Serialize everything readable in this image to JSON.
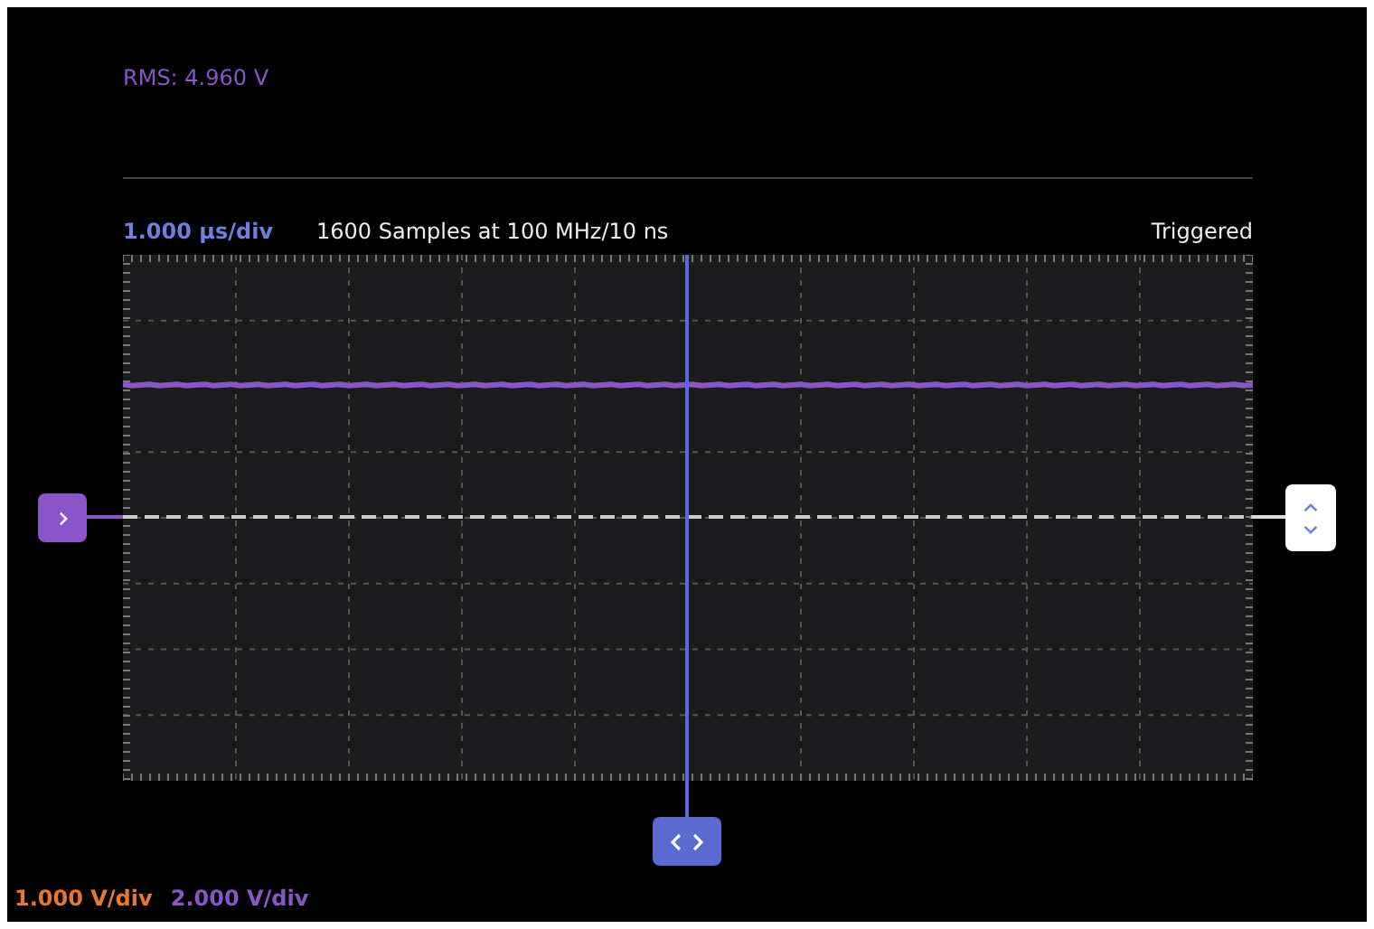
{
  "measurement": {
    "text": "RMS: 4.960 V"
  },
  "header": {
    "timebase": "1.000 µs/div",
    "sample_info": "1600 Samples at 100 MHz/10 ns",
    "trigger_status": "Triggered"
  },
  "channel_scales": [
    {
      "text": "1.000 V/div",
      "color": "#e8782a"
    },
    {
      "text": "2.000 V/div",
      "color": "#8a55c8"
    }
  ]
}
